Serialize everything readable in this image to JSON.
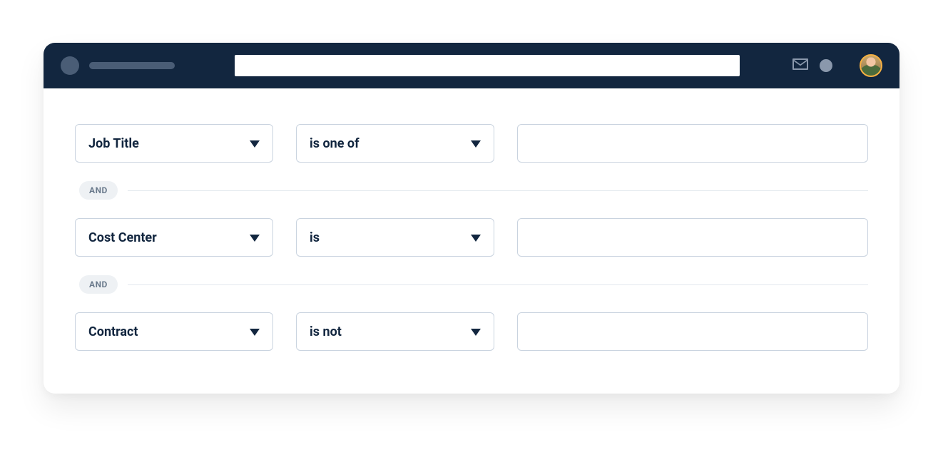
{
  "header": {
    "search_value": ""
  },
  "connectors": {
    "and_label": "AND"
  },
  "rules": [
    {
      "field": "Job Title",
      "operator": "is one of",
      "value": ""
    },
    {
      "field": "Cost Center",
      "operator": "is",
      "value": ""
    },
    {
      "field": "Contract",
      "operator": "is not",
      "value": ""
    }
  ]
}
